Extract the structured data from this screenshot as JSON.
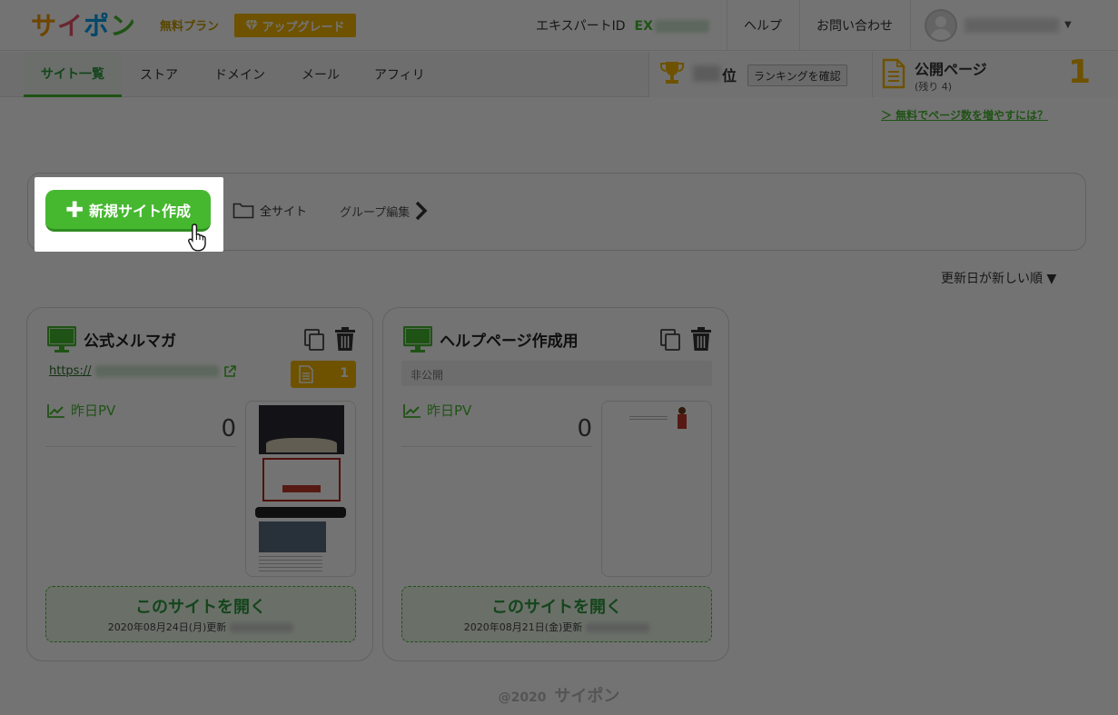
{
  "header": {
    "logo": [
      "サ",
      "イ",
      "ポ",
      "ン"
    ],
    "plan_label": "無料プラン",
    "upgrade_label": "アップグレード",
    "expert_label": "エキスパートID",
    "expert_prefix": "EX",
    "help_label": "ヘルプ",
    "contact_label": "お問い合わせ"
  },
  "nav": {
    "items": [
      "サイト一覧",
      "ストア",
      "ドメイン",
      "メール",
      "アフィリ"
    ],
    "rank_suffix": "位",
    "rank_button": "ランキングを確認",
    "public_title": "公開ページ",
    "public_remaining": "(残り 4)",
    "public_count": "1",
    "free_link": "＞ 無料でページ数を増やすには？"
  },
  "toolbar": {
    "new_site_label": "新規サイト作成",
    "all_sites_label": "全サイト",
    "group_edit_label": "グループ編集"
  },
  "sort_label": "更新日が新しい順 ▼",
  "cards": [
    {
      "title": "公式メルマガ",
      "url_prefix": "https://",
      "page_count": "1",
      "pv_label": "昨日PV",
      "pv_value": "0",
      "open_label": "このサイトを開く",
      "updated": "2020年08月24日(月)更新"
    },
    {
      "title": "ヘルプページ作成用",
      "status": "非公開",
      "pv_label": "昨日PV",
      "pv_value": "0",
      "open_label": "このサイトを開く",
      "updated": "2020年08月21日(金)更新"
    }
  ],
  "footer": {
    "copyright": "@2020",
    "logo_text": "サイポン"
  },
  "colors": {
    "brand_green": "#46b830",
    "accent_gold": "#f3b700"
  }
}
